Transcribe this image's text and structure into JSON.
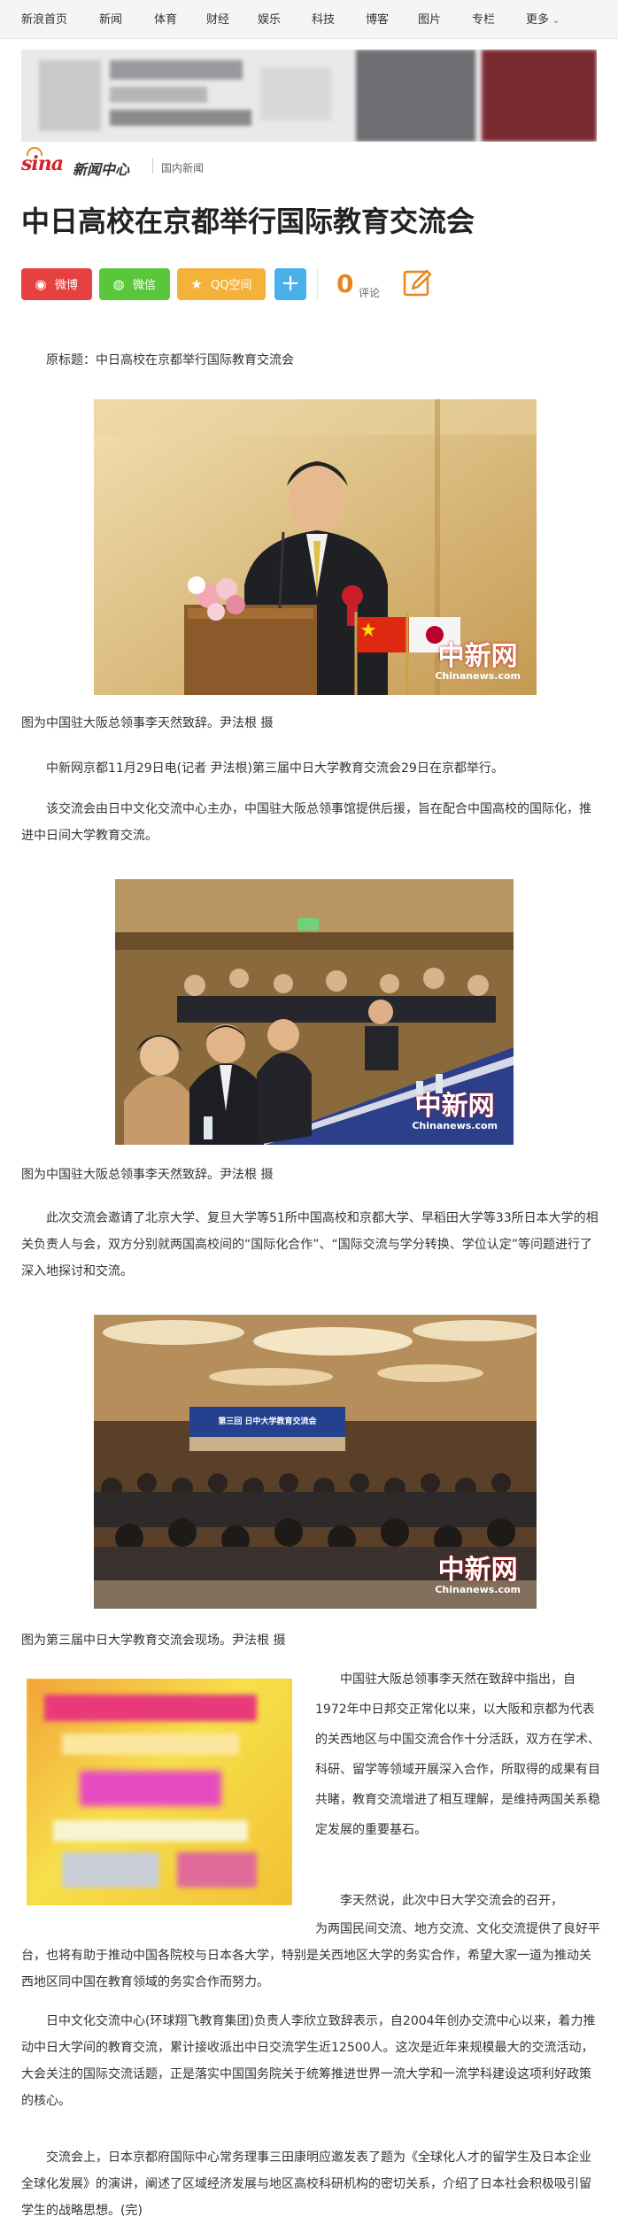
{
  "nav": {
    "items": [
      "新浪首页",
      "新闻",
      "体育",
      "财经",
      "娱乐",
      "科技",
      "博客",
      "图片",
      "专栏",
      "更多"
    ]
  },
  "brand": {
    "logo": "sina",
    "center": "新闻中心",
    "channel": "国内新闻"
  },
  "article": {
    "title": "中日高校在京都举行国际教育交流会",
    "share": {
      "weibo": "微博",
      "wechat": "微信",
      "qq": "QQ空间",
      "plus": "+"
    },
    "comments": {
      "count": "0",
      "label": "评论"
    },
    "original_title": "原标题：中日高校在京都举行国际教育交流会",
    "watermark_cn": "中新网",
    "watermark_en": "Chinanews.com",
    "caption1": "图为中国驻大阪总领事李天然致辞。尹法根 摄",
    "p1": "中新网京都11月29日电(记者 尹法根)第三届中日大学教育交流会29日在京都举行。",
    "p2": "该交流会由日中文化交流中心主办，中国驻大阪总领事馆提供后援，旨在配合中国高校的国际化，推进中日间大学教育交流。",
    "caption2": "图为中国驻大阪总领事李天然致辞。尹法根 摄",
    "p3": "此次交流会邀请了北京大学、复旦大学等51所中国高校和京都大学、早稻田大学等33所日本大学的相关负责人与会，双方分别就两国高校间的“国际化合作”、“国际交流与学分转换、学位认定”等问题进行了深入地探讨和交流。",
    "banner_text": "第三回 日中大学教育交流会",
    "caption3": "图为第三届中日大学教育交流会现场。尹法根 摄",
    "p4": "中国驻大阪总领事李天然在致辞中指出，自1972年中日邦交正常化以来，以大阪和京都为代表的关西地区与中国交流合作十分活跃，双方在学术、科研、留学等领域开展深入合作，所取得的成果有目共睹，教育交流增进了相互理解，是维持两国关系稳定发展的重要基石。",
    "p5a": "李天然说，此次中日大学交流会的召开，",
    "p5b": "为两国民间交流、地方交流、文化交流提供了良好平台，也将有助于推动中国各院校与日本各大学，特别是关西地区大学的务实合作，希望大家一道为推动关西地区同中国在教育领域的务实合作而努力。",
    "p6": "日中文化交流中心(环球翔飞教育集团)负责人李欣立致辞表示，自2004年创办交流中心以来，着力推动中日大学间的教育交流，累计接收派出中日交流学生近12500人。这次是近年来规模最大的交流活动，大会关注的国际交流话题，正是落实中国国务院关于统筹推进世界一流大学和一流学科建设这项利好政策的核心。",
    "p7": "交流会上，日本京都府国际中心常务理事三田康明应邀发表了题为《全球化人才的留学生及日本企业全球化发展》的演讲，阐述了区域经济发展与地区高校科研机构的密切关系，介绍了日本社会积极吸引留学生的战略思想。(完)"
  },
  "colors": {
    "weibo": "#e64141",
    "wechat": "#5ac73b",
    "qq": "#f4b23b",
    "plus": "#49b0e8",
    "comment": "#e8851c",
    "sina_red": "#d2232a"
  }
}
